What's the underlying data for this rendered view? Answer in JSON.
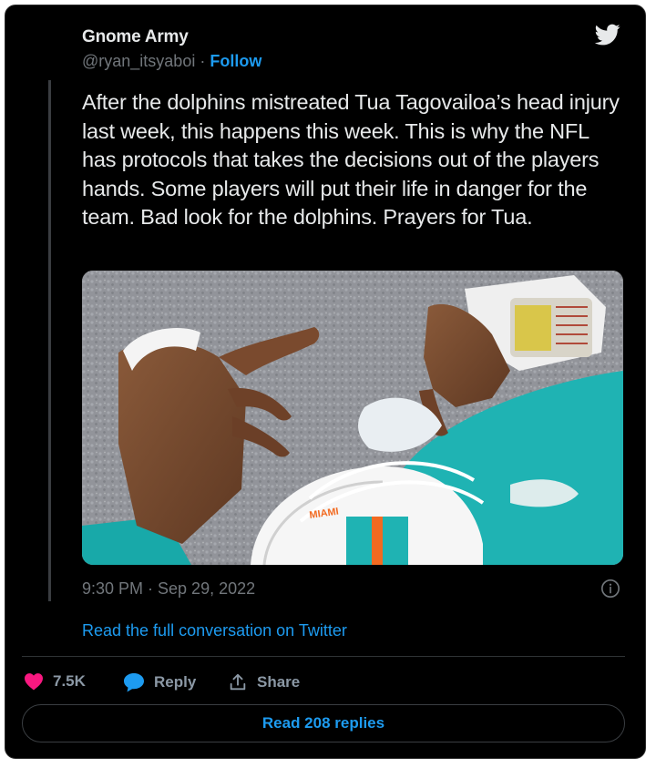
{
  "author": {
    "display_name": "Gnome Army",
    "handle": "@ryan_itsyaboi",
    "separator": "·",
    "follow_label": "Follow"
  },
  "tweet": {
    "text": "After the dolphins mistreated Tua Tagovailoa’s head injury last week, this happens this week. This is why the NFL has protocols that takes the decisions out of the players hands. Some players will put their life in danger for the team. Bad look for the dolphins. Prayers for Tua.",
    "timestamp": "9:30 PM · Sep 29, 2022",
    "read_conversation": "Read the full conversation on Twitter"
  },
  "media": {
    "helmet_lettering": "MIAMI"
  },
  "actions": {
    "likes_count": "7.5K",
    "reply_label": "Reply",
    "share_label": "Share",
    "read_replies_label": "Read 208 replies"
  },
  "icons": {
    "logo": "twitter-bird-icon",
    "like": "heart-icon",
    "reply": "speech-bubble-icon",
    "share": "share-upload-icon",
    "info": "info-icon"
  },
  "colors": {
    "background": "#000000",
    "primary_text": "#e7e9ea",
    "secondary_text": "#71767b",
    "link_blue": "#1d9bf0",
    "like_pink": "#f91880",
    "dolphins_aqua": "#1fb3b3"
  }
}
